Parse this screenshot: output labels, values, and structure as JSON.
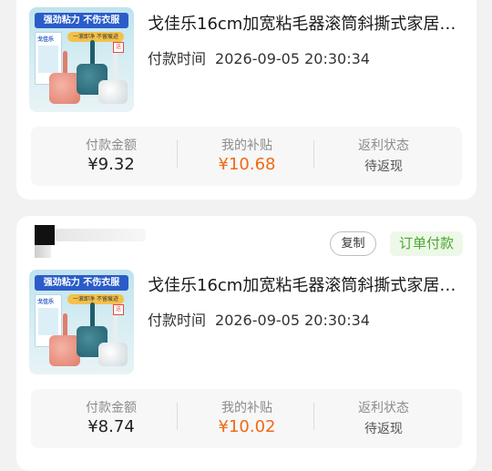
{
  "orders": [
    {
      "product_title": "戈佳乐16cm加宽粘毛器滚筒斜撕式家居…",
      "pay_time_label": "付款时间",
      "pay_time": "2026-09-05 20:30:34",
      "thumb": {
        "banner": "强劲粘力 不伤衣服",
        "box_label": "戈佳乐",
        "tag": "一滚即净 不留痕迹",
        "badge": "送"
      },
      "stats": {
        "paid_label": "付款金额",
        "paid_value": "¥9.32",
        "subsidy_label": "我的补贴",
        "subsidy_value": "¥10.68",
        "rebate_label": "返利状态",
        "rebate_value": "待返现"
      }
    },
    {
      "product_title": "戈佳乐16cm加宽粘毛器滚筒斜撕式家居…",
      "pay_time_label": "付款时间",
      "pay_time": "2026-09-05 20:30:34",
      "copy_label": "复制",
      "status_label": "订单付款",
      "thumb": {
        "banner": "强劲粘力 不伤衣服",
        "box_label": "戈佳乐",
        "tag": "一滚即净 不留痕迹",
        "badge": "送"
      },
      "stats": {
        "paid_label": "付款金额",
        "paid_value": "¥8.74",
        "subsidy_label": "我的补贴",
        "subsidy_value": "¥10.02",
        "rebate_label": "返利状态",
        "rebate_value": "待返现"
      }
    }
  ],
  "colors": {
    "accent_orange": "#f06a12",
    "status_green": "#4aa632",
    "status_green_bg": "#eef8e8",
    "page_bg": "#f2f2f2"
  }
}
